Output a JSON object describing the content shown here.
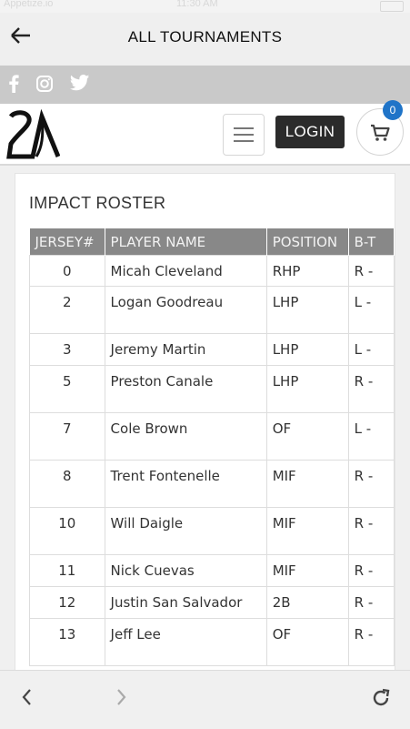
{
  "status": {
    "carrier": "Appetize.io",
    "time": "11:30 AM"
  },
  "nav": {
    "title": "ALL TOURNAMENTS",
    "back_icon": "arrow-left-icon"
  },
  "social": {
    "items": [
      "facebook-icon",
      "instagram-icon",
      "twitter-icon"
    ]
  },
  "header": {
    "login_label": "LOGIN",
    "cart_count": "0",
    "logo_icon": "2d-logo"
  },
  "roster": {
    "title": "IMPACT ROSTER",
    "columns": [
      "JERSEY#",
      "PLAYER NAME",
      "POSITION",
      "B-T"
    ],
    "rows": [
      {
        "jersey": "0",
        "name": "Micah Cleveland",
        "position": "RHP",
        "bt": "R -"
      },
      {
        "jersey": "2",
        "name": "Logan Goodreau",
        "position": "LHP",
        "bt": "L -"
      },
      {
        "jersey": "3",
        "name": "Jeremy Martin",
        "position": "LHP",
        "bt": "L -"
      },
      {
        "jersey": "5",
        "name": "Preston Canale",
        "position": "LHP",
        "bt": "R -"
      },
      {
        "jersey": "7",
        "name": "Cole Brown",
        "position": "OF",
        "bt": "L -"
      },
      {
        "jersey": "8",
        "name": "Trent Fontenelle",
        "position": "MIF",
        "bt": "R -"
      },
      {
        "jersey": "10",
        "name": "Will Daigle",
        "position": "MIF",
        "bt": "R -"
      },
      {
        "jersey": "11",
        "name": "Nick Cuevas",
        "position": "MIF",
        "bt": "R -"
      },
      {
        "jersey": "12",
        "name": "Justin San Salvador",
        "position": "2B",
        "bt": "R -"
      },
      {
        "jersey": "13",
        "name": "Jeff Lee",
        "position": "OF",
        "bt": "R -"
      }
    ]
  },
  "browser": {
    "back_icon": "chevron-left-icon",
    "forward_icon": "chevron-right-icon",
    "reload_icon": "reload-icon"
  }
}
